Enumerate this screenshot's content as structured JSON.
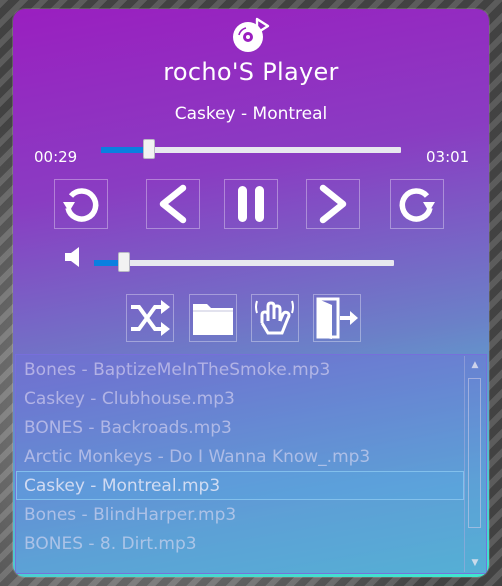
{
  "app": {
    "title": "rocho'S Player",
    "logo_icon": "music-disc-play-icon"
  },
  "now_playing": {
    "track": "Caskey - Montreal",
    "elapsed": "00:29",
    "duration": "03:01",
    "progress": 0.16
  },
  "controls": {
    "replay_icon": "rewind-circle-icon",
    "prev_icon": "chevron-left-icon",
    "pause_icon": "pause-icon",
    "next_icon": "chevron-right-icon",
    "forward_icon": "forward-circle-icon"
  },
  "volume": {
    "icon": "speaker-icon",
    "level": 0.1
  },
  "toolbar": {
    "shuffle_icon": "shuffle-icon",
    "folder_icon": "folder-icon",
    "shake_icon": "hand-shake-icon",
    "exit_icon": "exit-door-icon"
  },
  "playlist": {
    "items": [
      "Bones - BaptizeMeInTheSmoke.mp3",
      "Caskey - Clubhouse.mp3",
      "BONES - Backroads.mp3",
      "Arctic Monkeys - Do I Wanna Know_.mp3",
      "Caskey - Montreal.mp3",
      "Bones - BlindHarper.mp3",
      "BONES - 8. Dirt.mp3"
    ],
    "selected_index": 4
  },
  "colors": {
    "accent": "#0a7fe0",
    "gradient_top": "#9a1fc0",
    "gradient_bottom": "#3fe6cf"
  }
}
